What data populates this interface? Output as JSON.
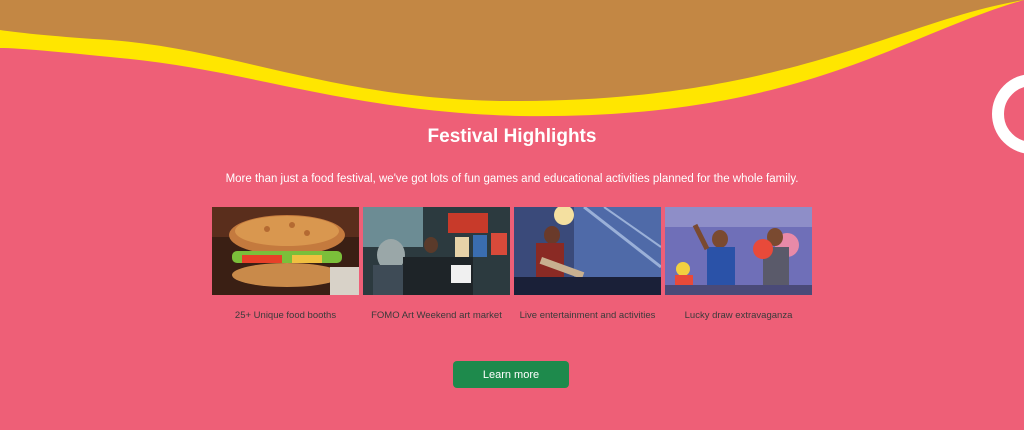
{
  "colors": {
    "page_background": "#ee5f77",
    "wave_brown": "#c38744",
    "wave_yellow": "#ffe600",
    "button_green": "#1e8a4c",
    "heading_text": "#ffffff"
  },
  "highlights": {
    "title": "Festival Highlights",
    "subtitle": "More than just a food festival, we've got lots of fun games and educational activities planned for the whole family.",
    "items": [
      {
        "caption": "25+ Unique food booths",
        "image": "sandwich-photo"
      },
      {
        "caption": "FOMO Art Weekend art market",
        "image": "art-market-photo"
      },
      {
        "caption": "Live entertainment and activities",
        "image": "live-band-photo"
      },
      {
        "caption": "Lucky draw extravaganza",
        "image": "lucky-draw-photo"
      }
    ]
  },
  "cta": {
    "label": "Learn more"
  }
}
